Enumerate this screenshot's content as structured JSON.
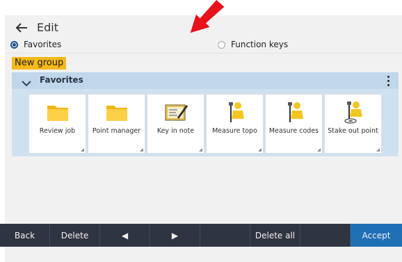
{
  "header": {
    "title": "Edit",
    "radio_favorites": "Favorites",
    "radio_function_keys": "Function keys",
    "selected": "Favorites"
  },
  "new_group_label": "New group",
  "group": {
    "title": "Favorites",
    "items": [
      {
        "label": "Review job",
        "icon": "folder-icon"
      },
      {
        "label": "Point manager",
        "icon": "folder-icon"
      },
      {
        "label": "Key in note",
        "icon": "note-icon"
      },
      {
        "label": "Measure topo",
        "icon": "surveyor-icon"
      },
      {
        "label": "Measure codes",
        "icon": "surveyor-icon"
      },
      {
        "label": "Stake out point",
        "icon": "stakeout-icon"
      }
    ]
  },
  "footer": {
    "back": "Back",
    "delete": "Delete",
    "prev": "◀",
    "next": "▶",
    "delete_all": "Delete all",
    "accept": "Accept"
  },
  "colors": {
    "accent": "#1f6fb5",
    "highlight": "#f6b81b",
    "panel": "#cfe1ef",
    "footer": "#2e3440",
    "annotation_arrow": "#e8121b"
  }
}
